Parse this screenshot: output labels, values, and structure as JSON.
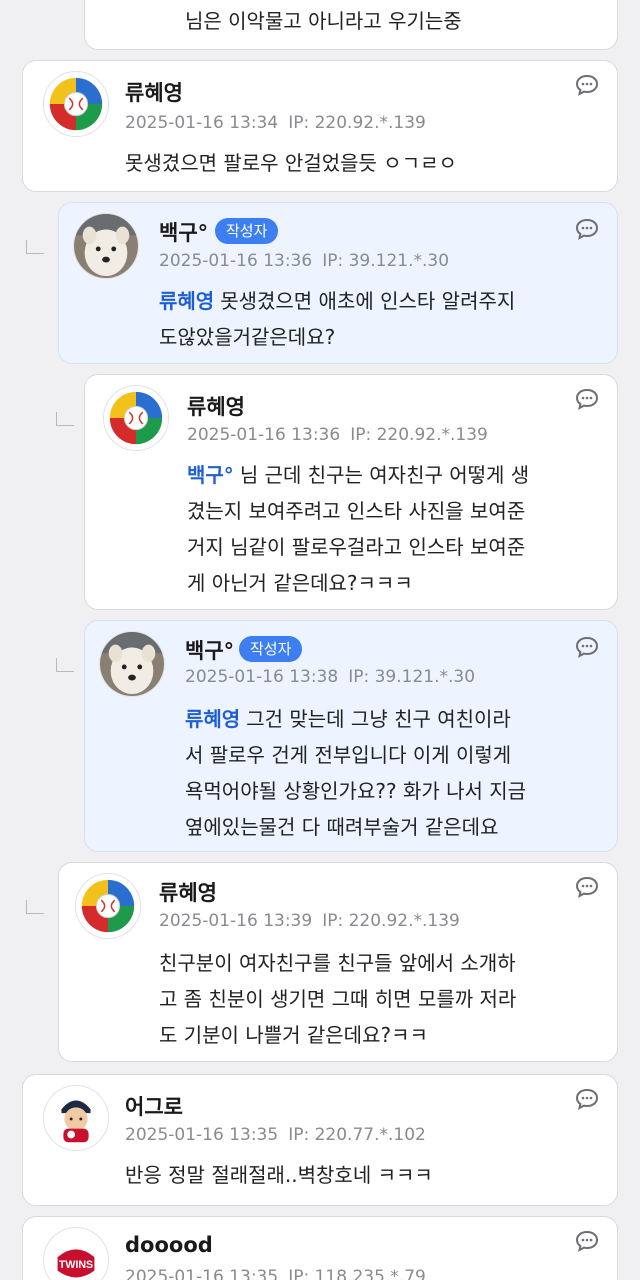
{
  "comments": [
    {
      "body": "님은 이악물고 아니라고 우기는중"
    },
    {
      "name": "류혜영",
      "date": "2025-01-16 13:34",
      "ip": "IP: 220.92.*.139",
      "body": "못생겼으면 팔로우 안걸었을듯 ㅇㄱㄹㅇ",
      "avatar": "baseball-logo"
    },
    {
      "name": "백구°",
      "badge": "작성자",
      "date": "2025-01-16 13:36",
      "ip": "IP: 39.121.*.30",
      "mention": "류혜영",
      "body_lines": [
        "못생겼으면 애초에 인스타 알려주지",
        "도않았을거같은데요?"
      ],
      "avatar": "dog-photo"
    },
    {
      "name": "류혜영",
      "date": "2025-01-16 13:36",
      "ip": "IP: 220.92.*.139",
      "mention": "백구°",
      "body_lines": [
        "님 근데 친구는 여자친구 어떻게 생",
        "겼는지 보여주려고 인스타 사진을 보여준",
        "거지 님같이 팔로우걸라고 인스타 보여준",
        "게 아닌거 같은데요?ㅋㅋㅋ"
      ],
      "avatar": "baseball-logo"
    },
    {
      "name": "백구°",
      "badge": "작성자",
      "date": "2025-01-16 13:38",
      "ip": "IP: 39.121.*.30",
      "mention": "류혜영",
      "body_lines": [
        "그건 맞는데 그냥 친구 여친이라",
        "서 팔로우 건게 전부입니다 이게 이렇게",
        "욕먹어야될 상황인가요?? 화가 나서 지금",
        "옆에있는물건 다 때려부술거 같은데요"
      ],
      "avatar": "dog-photo"
    },
    {
      "name": "류혜영",
      "date": "2025-01-16 13:39",
      "ip": "IP: 220.92.*.139",
      "body_lines": [
        "친구분이 여자친구를 친구들 앞에서 소개하",
        "고 좀 친분이 생기면 그때 히면 모를까 저라",
        "도 기분이 나쁠거 같은데요?ㅋㅋ"
      ],
      "avatar": "baseball-logo"
    },
    {
      "name": "어그로",
      "date": "2025-01-16 13:35",
      "ip": "IP: 220.77.*.102",
      "body": "반응 정말 절래절래..벽창호네 ㅋㅋㅋ",
      "avatar": "cartoon-player"
    },
    {
      "name": "dooood",
      "date": "2025-01-16 13:35",
      "ip": "IP: 118.235.*.79",
      "avatar": "lg-twins-logo",
      "avatar_text": "TWINS"
    }
  ],
  "colors": {
    "mention": "#1f5fd6",
    "badge": "#3d7ff1",
    "author_bg": "#eef4ff"
  }
}
